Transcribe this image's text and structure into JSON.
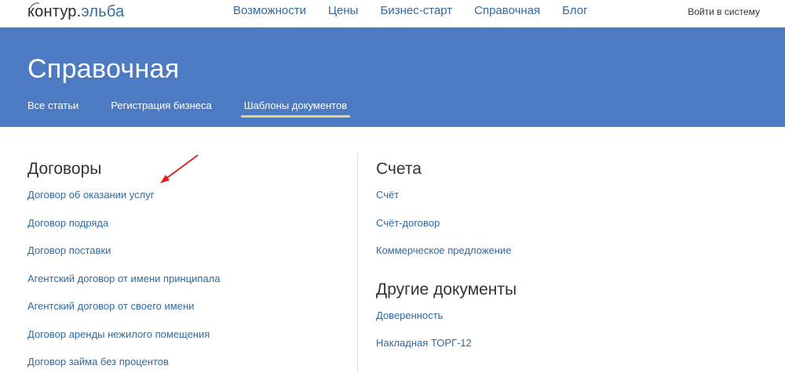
{
  "header": {
    "logo_prefix": "контур.",
    "logo_suffix": "эльба",
    "nav": [
      "Возможности",
      "Цены",
      "Бизнес-старт",
      "Справочная",
      "Блог"
    ],
    "login": "Войти в систему"
  },
  "banner": {
    "title": "Справочная",
    "tabs": [
      "Все статьи",
      "Регистрация бизнеса",
      "Шаблоны документов"
    ],
    "active_tab": "Шаблоны документов",
    "background_color": "#4c7ac3",
    "active_underline_color": "#f7d37e"
  },
  "left": {
    "title": "Договоры",
    "links": [
      "Договор об оказании услуг",
      "Договор подряда",
      "Договор поставки",
      "Агентский договор от имени принципала",
      "Агентский договор от своего имени",
      "Договор аренды нежилого помещения",
      "Договор займа без процентов"
    ]
  },
  "right": {
    "sections": [
      {
        "title": "Счета",
        "links": [
          "Счёт",
          "Счёт-договор",
          "Коммерческое предложение"
        ]
      },
      {
        "title": "Другие документы",
        "links": [
          "Доверенность",
          "Накладная ТОРГ-12"
        ]
      }
    ]
  },
  "annotation": {
    "arrow_color": "#e02020"
  }
}
